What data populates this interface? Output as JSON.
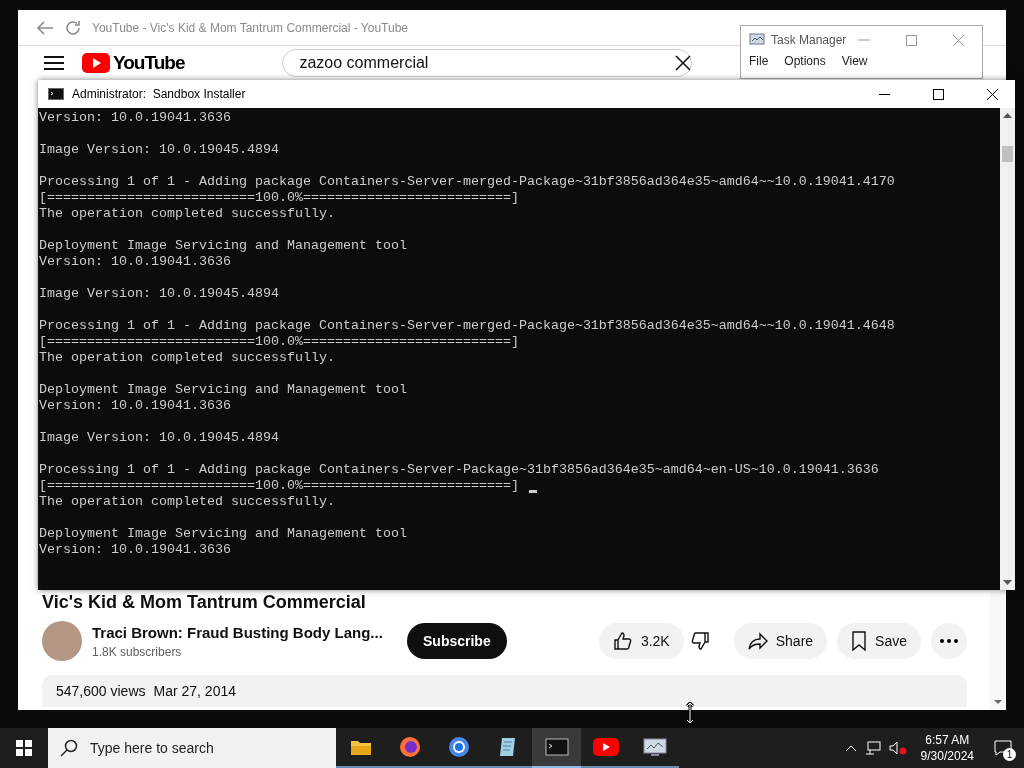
{
  "browser": {
    "tab_title": "YouTube - Vic's Kid & Mom Tantrum Commercial - YouTube",
    "logo": "YouTube",
    "search": {
      "value": "zazoo commercial"
    },
    "video": {
      "title": "Vic's Kid & Mom Tantrum Commercial",
      "channel": "Traci Brown: Fraud Busting Body Lang...",
      "subscribers": "1.8K subscribers",
      "subscribe": "Subscribe",
      "likes": "3.2K",
      "share": "Share",
      "save": "Save",
      "views": "547,600 views",
      "date": "Mar 27, 2014"
    }
  },
  "console": {
    "title": "Administrator:  Sandbox Installer",
    "blocks": [
      [
        "Version: 10.0.19041.3636"
      ],
      [
        "Image Version: 10.0.19045.4894"
      ],
      [
        "Processing 1 of 1 - Adding package Containers-Server-merged-Package~31bf3856ad364e35~amd64~~10.0.19041.4170",
        "[==========================100.0%==========================]",
        "The operation completed successfully."
      ],
      [
        "Deployment Image Servicing and Management tool",
        "Version: 10.0.19041.3636"
      ],
      [
        "Image Version: 10.0.19045.4894"
      ],
      [
        "Processing 1 of 1 - Adding package Containers-Server-merged-Package~31bf3856ad364e35~amd64~~10.0.19041.4648",
        "[==========================100.0%==========================]",
        "The operation completed successfully."
      ],
      [
        "Deployment Image Servicing and Management tool",
        "Version: 10.0.19041.3636"
      ],
      [
        "Image Version: 10.0.19045.4894"
      ],
      [
        "Processing 1 of 1 - Adding package Containers-Server-Package~31bf3856ad364e35~amd64~en-US~10.0.19041.3636",
        "[==========================100.0%==========================]",
        "The operation completed successfully."
      ],
      [
        "Deployment Image Servicing and Management tool",
        "Version: 10.0.19041.3636"
      ]
    ]
  },
  "task_manager": {
    "title": "Task Manager",
    "menu": [
      "File",
      "Options",
      "View"
    ]
  },
  "taskbar": {
    "search_placeholder": "Type here to search",
    "apps": [
      {
        "kind": "folder",
        "selected": false
      },
      {
        "kind": "firefox",
        "selected": false
      },
      {
        "kind": "chrome",
        "selected": false
      },
      {
        "kind": "notepad",
        "selected": false
      },
      {
        "kind": "terminal",
        "selected": true
      },
      {
        "kind": "youtube",
        "selected": false
      },
      {
        "kind": "monitor",
        "selected": false
      }
    ],
    "time": "6:57 AM",
    "date": "9/30/2024",
    "notifications": "1"
  }
}
